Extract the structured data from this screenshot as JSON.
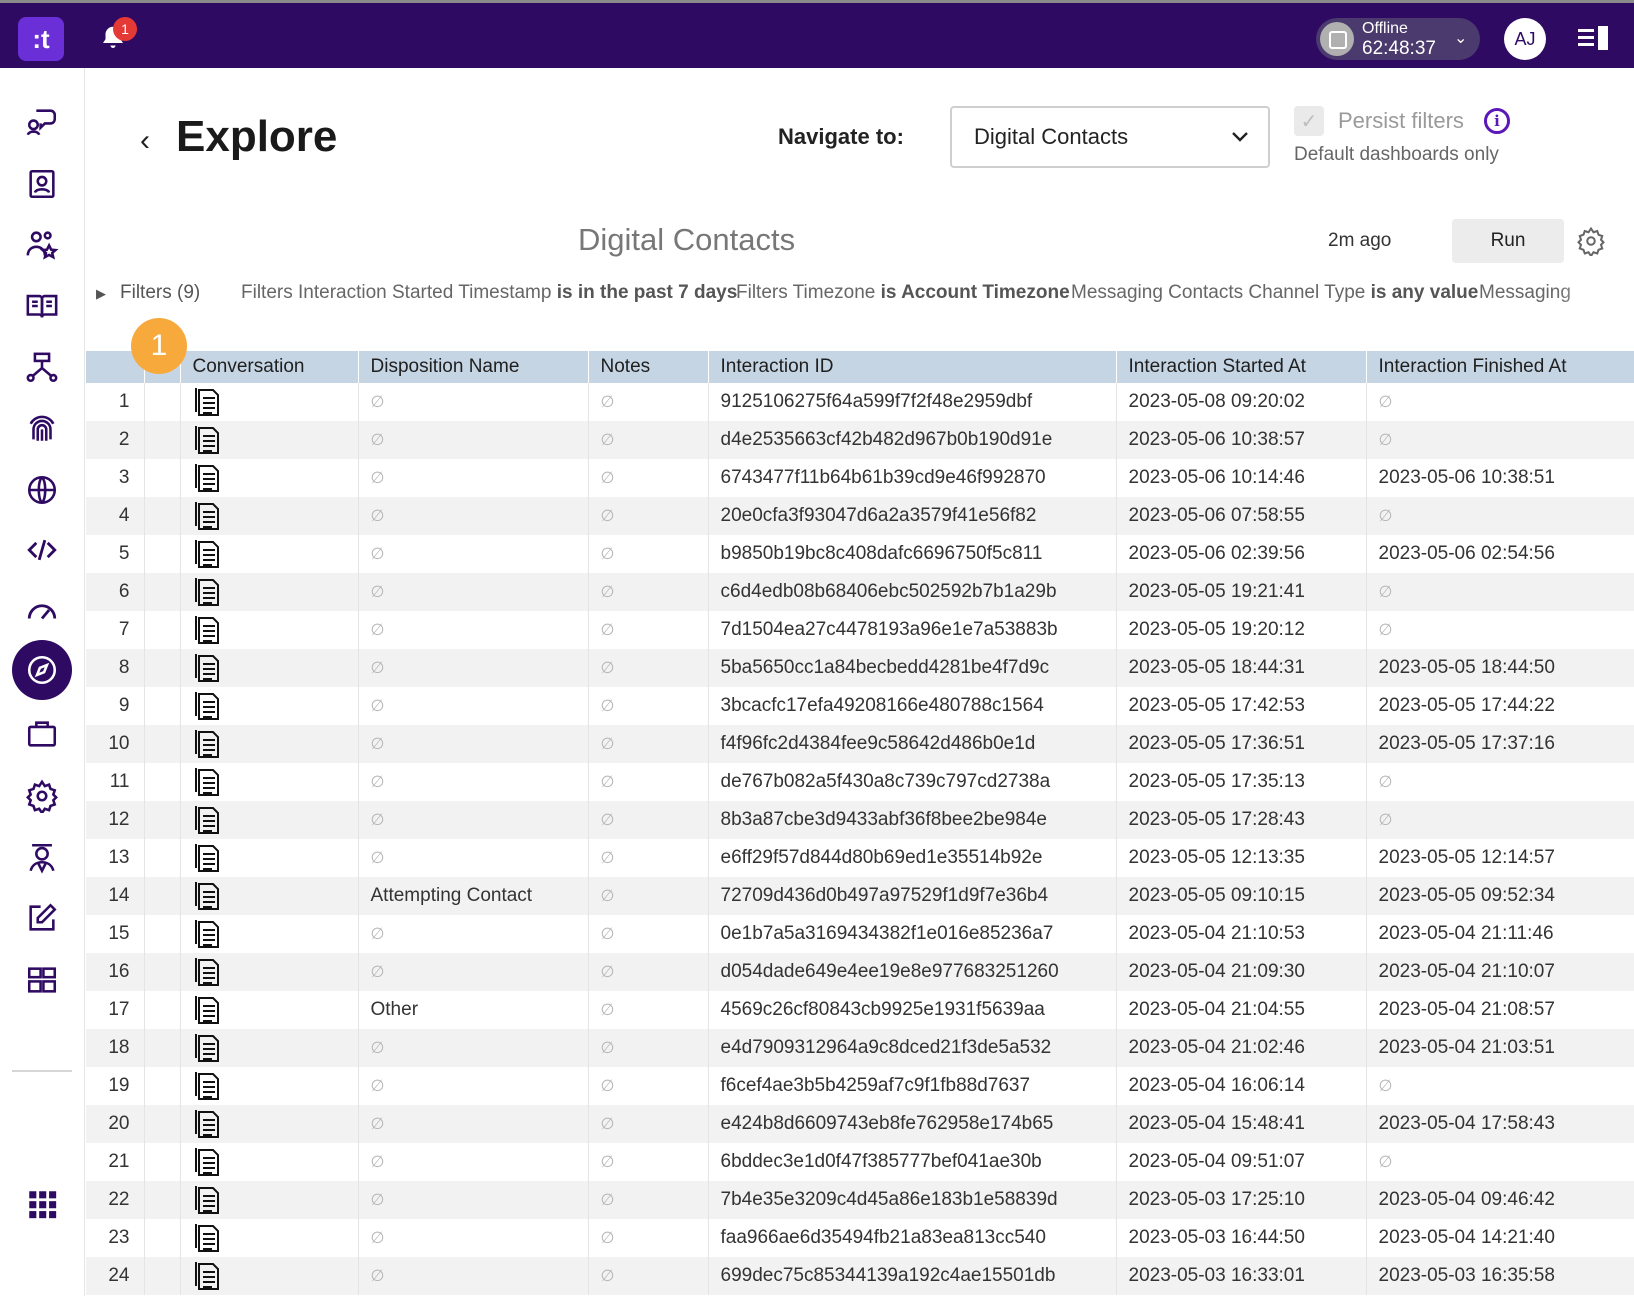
{
  "topbar": {
    "logo_text": ":t",
    "notification_count": "1",
    "status_label": "Offline",
    "status_timer": "62:48:37",
    "avatar_initials": "AJ"
  },
  "sidebar": {
    "items": [
      {
        "icon": "conversations-icon"
      },
      {
        "icon": "contacts-icon"
      },
      {
        "icon": "teams-icon"
      },
      {
        "icon": "knowledge-book-icon"
      },
      {
        "icon": "workflow-icon"
      },
      {
        "icon": "fingerprint-icon"
      },
      {
        "icon": "globe-icon"
      },
      {
        "icon": "code-icon"
      },
      {
        "icon": "gauge-icon"
      },
      {
        "icon": "explore-compass-icon",
        "active": true
      },
      {
        "icon": "briefcase-icon"
      },
      {
        "icon": "settings-gear-icon"
      },
      {
        "icon": "agent-icon"
      },
      {
        "icon": "edit-icon"
      },
      {
        "icon": "dashboard-grid-icon"
      }
    ],
    "apps_icon": "apps-grid-icon"
  },
  "header": {
    "title": "Explore",
    "navigate_label": "Navigate to:",
    "navigate_value": "Digital Contacts",
    "persist_label": "Persist filters",
    "persist_sub": "Default dashboards only"
  },
  "dashboard": {
    "title": "Digital Contacts",
    "updated": "2m ago",
    "run_label": "Run",
    "filters_label": "Filters (9)",
    "filters": [
      {
        "field": "Filters Interaction Started Timestamp",
        "condition": "is in the past 7 days"
      },
      {
        "field": "Filters Timezone",
        "condition": "is Account Timezone"
      },
      {
        "field": "Messaging Contacts Channel Type",
        "condition": "is any value"
      },
      {
        "field": "Messaging",
        "condition": ""
      }
    ]
  },
  "callout": "1",
  "table": {
    "columns": [
      "",
      "",
      "Conversation",
      "Disposition Name",
      "Notes",
      "Interaction ID",
      "Interaction Started At",
      "Interaction Finished At"
    ],
    "null_symbol": "∅",
    "rows": [
      {
        "n": "1",
        "disposition": "∅",
        "notes": "∅",
        "id": "9125106275f64a599f7f2f48e2959dbf",
        "started": "2023-05-08 09:20:02",
        "finished": "∅"
      },
      {
        "n": "2",
        "disposition": "∅",
        "notes": "∅",
        "id": "d4e2535663cf42b482d967b0b190d91e",
        "started": "2023-05-06 10:38:57",
        "finished": "∅"
      },
      {
        "n": "3",
        "disposition": "∅",
        "notes": "∅",
        "id": "6743477f11b64b61b39cd9e46f992870",
        "started": "2023-05-06 10:14:46",
        "finished": "2023-05-06 10:38:51"
      },
      {
        "n": "4",
        "disposition": "∅",
        "notes": "∅",
        "id": "20e0cfa3f93047d6a2a3579f41e56f82",
        "started": "2023-05-06 07:58:55",
        "finished": "∅"
      },
      {
        "n": "5",
        "disposition": "∅",
        "notes": "∅",
        "id": "b9850b19bc8c408dafc6696750f5c811",
        "started": "2023-05-06 02:39:56",
        "finished": "2023-05-06 02:54:56"
      },
      {
        "n": "6",
        "disposition": "∅",
        "notes": "∅",
        "id": "c6d4edb08b68406ebc502592b7b1a29b",
        "started": "2023-05-05 19:21:41",
        "finished": "∅"
      },
      {
        "n": "7",
        "disposition": "∅",
        "notes": "∅",
        "id": "7d1504ea27c4478193a96e1e7a53883b",
        "started": "2023-05-05 19:20:12",
        "finished": "∅"
      },
      {
        "n": "8",
        "disposition": "∅",
        "notes": "∅",
        "id": "5ba5650cc1a84becbedd4281be4f7d9c",
        "started": "2023-05-05 18:44:31",
        "finished": "2023-05-05 18:44:50"
      },
      {
        "n": "9",
        "disposition": "∅",
        "notes": "∅",
        "id": "3bcacfc17efa49208166e480788c1564",
        "started": "2023-05-05 17:42:53",
        "finished": "2023-05-05 17:44:22"
      },
      {
        "n": "10",
        "disposition": "∅",
        "notes": "∅",
        "id": "f4f96fc2d4384fee9c58642d486b0e1d",
        "started": "2023-05-05 17:36:51",
        "finished": "2023-05-05 17:37:16"
      },
      {
        "n": "11",
        "disposition": "∅",
        "notes": "∅",
        "id": "de767b082a5f430a8c739c797cd2738a",
        "started": "2023-05-05 17:35:13",
        "finished": "∅"
      },
      {
        "n": "12",
        "disposition": "∅",
        "notes": "∅",
        "id": "8b3a87cbe3d9433abf36f8bee2be984e",
        "started": "2023-05-05 17:28:43",
        "finished": "∅"
      },
      {
        "n": "13",
        "disposition": "∅",
        "notes": "∅",
        "id": "e6ff29f57d844d80b69ed1e35514b92e",
        "started": "2023-05-05 12:13:35",
        "finished": "2023-05-05 12:14:57"
      },
      {
        "n": "14",
        "disposition": "Attempting Contact",
        "notes": "∅",
        "id": "72709d436d0b497a97529f1d9f7e36b4",
        "started": "2023-05-05 09:10:15",
        "finished": "2023-05-05 09:52:34"
      },
      {
        "n": "15",
        "disposition": "∅",
        "notes": "∅",
        "id": "0e1b7a5a3169434382f1e016e85236a7",
        "started": "2023-05-04 21:10:53",
        "finished": "2023-05-04 21:11:46"
      },
      {
        "n": "16",
        "disposition": "∅",
        "notes": "∅",
        "id": "d054dade649e4ee19e8e977683251260",
        "started": "2023-05-04 21:09:30",
        "finished": "2023-05-04 21:10:07"
      },
      {
        "n": "17",
        "disposition": "Other",
        "notes": "∅",
        "id": "4569c26cf80843cb9925e1931f5639aa",
        "started": "2023-05-04 21:04:55",
        "finished": "2023-05-04 21:08:57"
      },
      {
        "n": "18",
        "disposition": "∅",
        "notes": "∅",
        "id": "e4d7909312964a9c8dced21f3de5a532",
        "started": "2023-05-04 21:02:46",
        "finished": "2023-05-04 21:03:51"
      },
      {
        "n": "19",
        "disposition": "∅",
        "notes": "∅",
        "id": "f6cef4ae3b5b4259af7c9f1fb88d7637",
        "started": "2023-05-04 16:06:14",
        "finished": "∅"
      },
      {
        "n": "20",
        "disposition": "∅",
        "notes": "∅",
        "id": "e424b8d6609743eb8fe762958e174b65",
        "started": "2023-05-04 15:48:41",
        "finished": "2023-05-04 17:58:43"
      },
      {
        "n": "21",
        "disposition": "∅",
        "notes": "∅",
        "id": "6bddec3e1d0f47f385777bef041ae30b",
        "started": "2023-05-04 09:51:07",
        "finished": "∅"
      },
      {
        "n": "22",
        "disposition": "∅",
        "notes": "∅",
        "id": "7b4e35e3209c4d45a86e183b1e58839d",
        "started": "2023-05-03 17:25:10",
        "finished": "2023-05-04 09:46:42"
      },
      {
        "n": "23",
        "disposition": "∅",
        "notes": "∅",
        "id": "faa966ae6d35494fb21a83ea813cc540",
        "started": "2023-05-03 16:44:50",
        "finished": "2023-05-04 14:21:40"
      },
      {
        "n": "24",
        "disposition": "∅",
        "notes": "∅",
        "id": "699dec75c85344139a192c4ae15501db",
        "started": "2023-05-03 16:33:01",
        "finished": "2023-05-03 16:35:58"
      }
    ]
  }
}
